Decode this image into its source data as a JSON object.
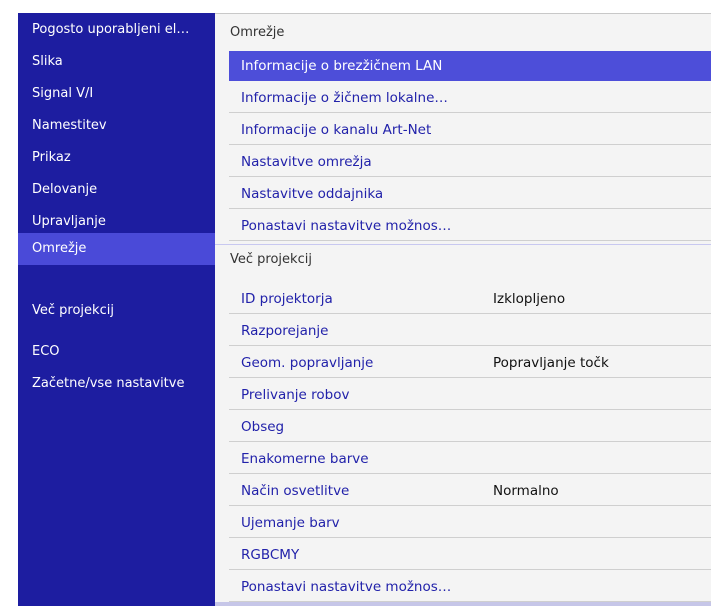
{
  "sidebar": {
    "items": [
      {
        "label": "Pogosto uporabljeni el…"
      },
      {
        "label": "Slika"
      },
      {
        "label": "Signal V/I"
      },
      {
        "label": "Namestitev"
      },
      {
        "label": "Prikaz"
      },
      {
        "label": "Delovanje"
      },
      {
        "label": "Upravljanje"
      },
      {
        "label": "Omrežje",
        "active": true
      },
      {
        "label": "Več projekcij"
      },
      {
        "label": "ECO"
      },
      {
        "label": "Začetne/vse nastavitve"
      }
    ]
  },
  "main": {
    "sections": [
      {
        "title": "Omrežje",
        "rows": [
          {
            "label": "Informacije o brezžičnem LAN",
            "selected": true
          },
          {
            "label": "Informacije o žičnem lokalne…"
          },
          {
            "label": "Informacije o kanalu Art-Net"
          },
          {
            "label": "Nastavitve omrežja"
          },
          {
            "label": "Nastavitve oddajnika"
          },
          {
            "label": "Ponastavi nastavitve možnos…"
          }
        ]
      },
      {
        "title": "Več projekcij",
        "rows": [
          {
            "label": "ID projektorja",
            "value": "Izklopljeno"
          },
          {
            "label": "Razporejanje"
          },
          {
            "label": "Geom. popravljanje",
            "value": "Popravljanje točk"
          },
          {
            "label": "Prelivanje robov"
          },
          {
            "label": "Obseg"
          },
          {
            "label": "Enakomerne barve"
          },
          {
            "label": "Način osvetlitve",
            "value": "Normalno"
          },
          {
            "label": "Ujemanje barv"
          },
          {
            "label": "RGBCMY"
          },
          {
            "label": "Ponastavi nastavitve možnos…"
          }
        ]
      }
    ]
  },
  "colors": {
    "sidebar_bg": "#1d1da0",
    "sidebar_active": "#4a4ad8",
    "selection": "#4d4ed9",
    "row_text": "#2222aa",
    "panel_bg": "#f4f4f4"
  }
}
